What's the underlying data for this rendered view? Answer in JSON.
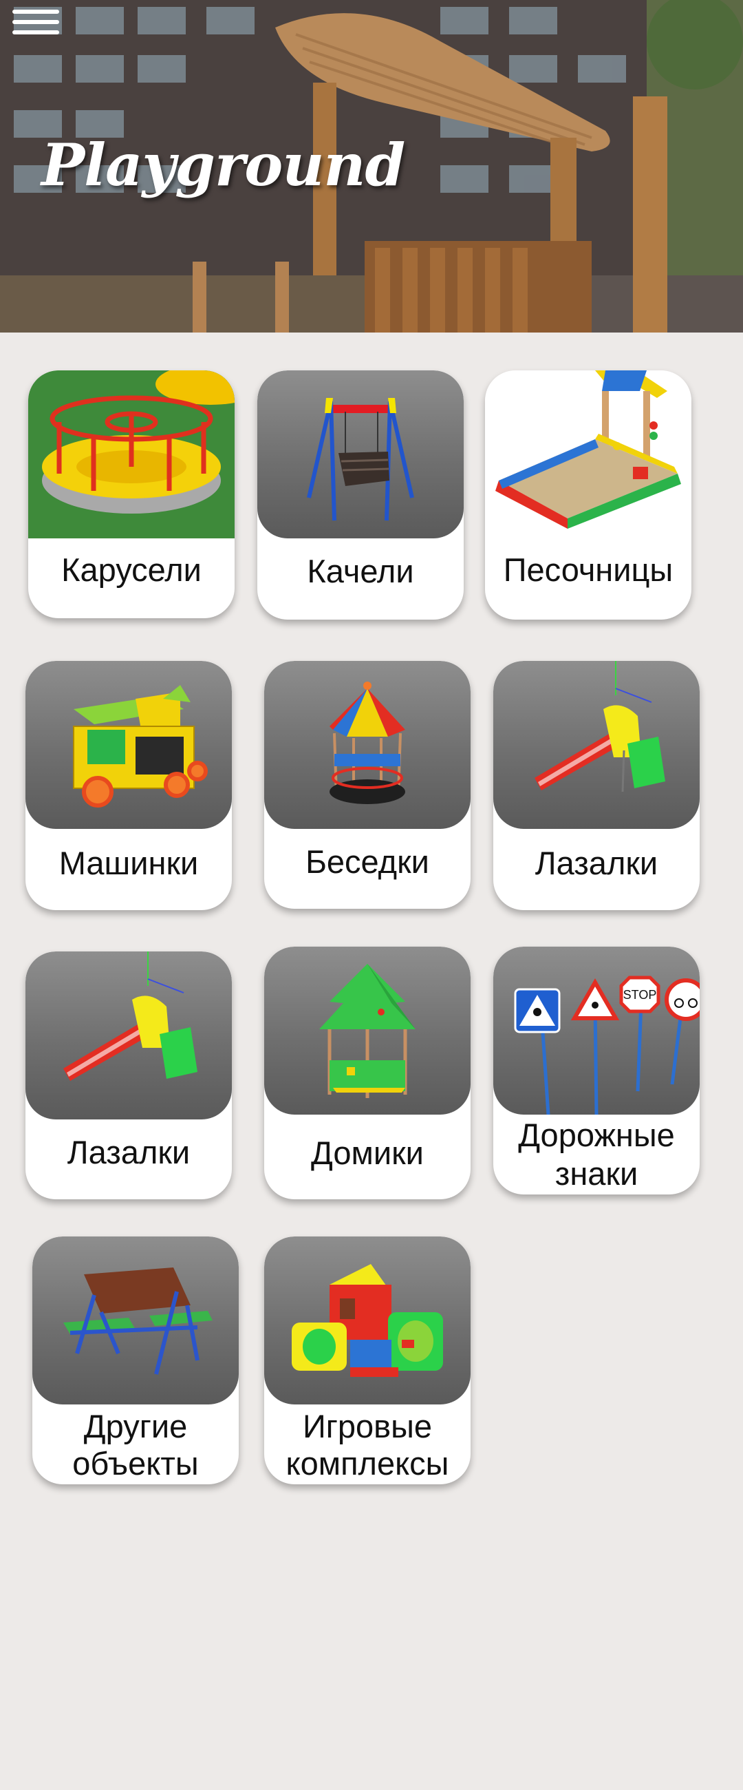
{
  "header": {
    "title": "Playground",
    "menu_icon": "hamburger-menu-icon"
  },
  "categories": [
    {
      "label": "Карусели",
      "icon": "carousel-icon"
    },
    {
      "label": "Качели",
      "icon": "swing-icon"
    },
    {
      "label": "Песочницы",
      "icon": "sandbox-icon"
    },
    {
      "label": "Машинки",
      "icon": "toy-car-icon"
    },
    {
      "label": "Беседки",
      "icon": "gazebo-icon"
    },
    {
      "label": "Лазалки",
      "icon": "slide-icon"
    },
    {
      "label": "Лазалки",
      "icon": "slide-icon"
    },
    {
      "label": "Домики",
      "icon": "playhouse-icon"
    },
    {
      "label_lines": [
        "Дорожные",
        "знаки"
      ],
      "icon": "road-signs-icon"
    },
    {
      "label_lines": [
        "Другие",
        "объекты"
      ],
      "icon": "picnic-table-icon"
    },
    {
      "label_lines": [
        "Игровые",
        "комплексы"
      ],
      "icon": "play-complex-icon"
    }
  ],
  "colors": {
    "page_background": "#edeae8",
    "card_background": "#ffffff",
    "thumb_gradient_top": "#8e8e8e",
    "thumb_gradient_bottom": "#5a5a5a"
  }
}
